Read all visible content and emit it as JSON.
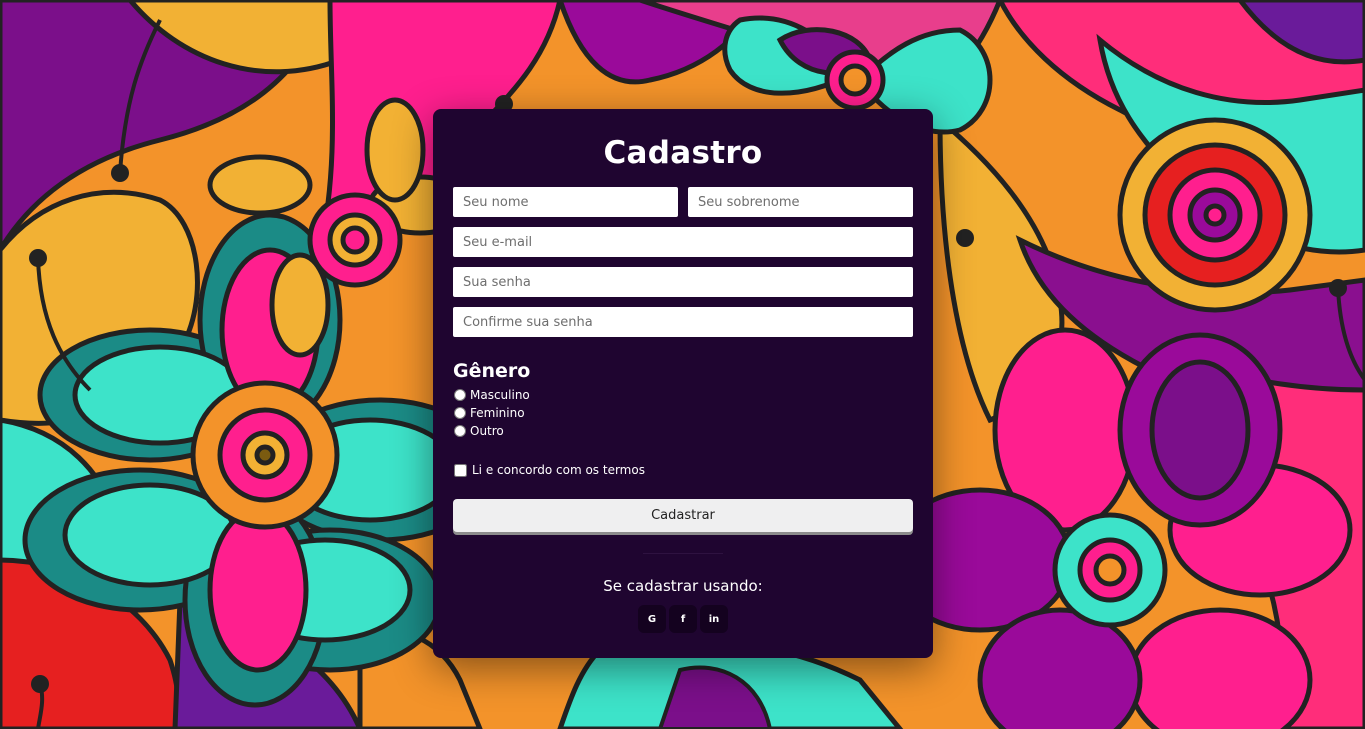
{
  "form": {
    "title": "Cadastro",
    "first_name_placeholder": "Seu nome",
    "last_name_placeholder": "Seu sobrenome",
    "email_placeholder": "Seu e-mail",
    "password_placeholder": "Sua senha",
    "confirm_password_placeholder": "Confirme sua senha",
    "gender_title": "Gênero",
    "gender_options": [
      "Masculino",
      "Feminino",
      "Outro"
    ],
    "terms_label": "Li e concordo com os termos",
    "submit_label": "Cadastrar",
    "social_title": "Se cadastrar usando:",
    "social_buttons": [
      {
        "glyph": "G",
        "icon": "google-icon"
      },
      {
        "glyph": "f",
        "icon": "facebook-icon"
      },
      {
        "glyph": "in",
        "icon": "linkedin-icon"
      }
    ]
  },
  "colors": {
    "card_background": "#1f0530",
    "social_button_background": "#14021f",
    "submit_background": "#efeff0"
  }
}
